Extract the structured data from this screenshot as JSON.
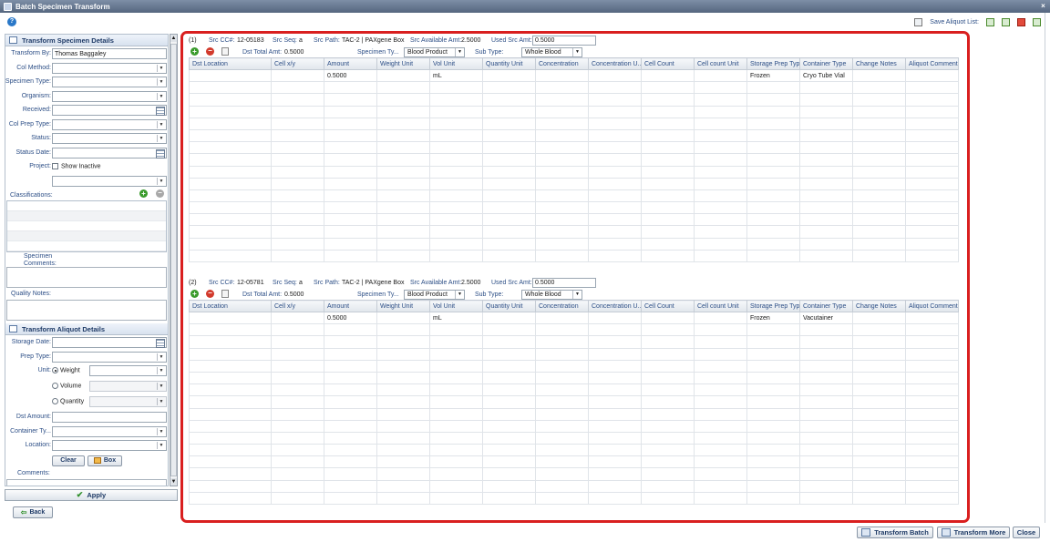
{
  "window": {
    "title": "Batch Specimen Transform",
    "help": "?",
    "close": "×"
  },
  "toolbar": {
    "save_aliquot_list": "Save Aliquot List:"
  },
  "left": {
    "specimen_section": "Transform Specimen Details",
    "transform_by_label": "Transform By:",
    "transform_by_value": "Thomas Baggaley",
    "col_method_label": "Col Method:",
    "specimen_type_label": "Specimen Type:",
    "organism_label": "Organism:",
    "received_label": "Received:",
    "col_prep_type_label": "Col Prep Type:",
    "status_label": "Status:",
    "status_date_label": "Status Date:",
    "project_label": "Project:",
    "show_inactive": "Show Inactive",
    "classifications_label": "Classifications:",
    "specimen_comments_label": "Specimen Comments:",
    "quality_notes_label": "Quality Notes:",
    "aliquot_section": "Transform Aliquot Details",
    "storage_date_label": "Storage Date:",
    "prep_type_label": "Prep Type:",
    "unit_label": "Unit:",
    "unit_weight": "Weight",
    "unit_volume": "Volume",
    "unit_quantity": "Quantity",
    "dst_amount_label": "Dst Amount:",
    "container_type_label": "Container Ty...",
    "location_label": "Location:",
    "clear_button": "Clear",
    "box_button": "Box",
    "comments_label": "Comments:",
    "apply_button": "Apply",
    "back_button": "Back"
  },
  "columns": [
    "Dst Location",
    "Cell x/y",
    "Amount",
    "Weight Unit",
    "Vol Unit",
    "Quantity Unit",
    "Concentration",
    "Concentration U...",
    "Cell Count",
    "Cell count Unit",
    "Storage Prep Type",
    "Container Type",
    "Change Notes",
    "Aliquot Comments"
  ],
  "groups": [
    {
      "index": "(1)",
      "src_cc_label": "Src CC#:",
      "src_cc": "12-05183",
      "src_seq_label": "Src Seq:",
      "src_seq": "a",
      "src_path_label": "Src Path:",
      "src_path": "TAC-2 | PAXgene Box",
      "src_avail_label": "Src Available Amt:",
      "src_avail": "2.5000",
      "used_src_label": "Used Src Amt:",
      "used_src": "0.5000",
      "dst_total_label": "Dst Total Amt:",
      "dst_total": "0.5000",
      "specimen_type_label": "Specimen Ty...",
      "specimen_type": "Blood Product",
      "sub_type_label": "Sub Type:",
      "sub_type": "Whole Blood",
      "row": [
        "",
        "",
        "0.5000",
        "",
        "mL",
        "",
        "",
        "",
        "",
        "",
        "Frozen",
        "Cryo Tube Vial",
        "",
        ""
      ]
    },
    {
      "index": "(2)",
      "src_cc_label": "Src CC#:",
      "src_cc": "12-05781",
      "src_seq_label": "Src Seq:",
      "src_seq": "a",
      "src_path_label": "Src Path:",
      "src_path": "TAC-2 | PAXgene Box",
      "src_avail_label": "Src Available Amt:",
      "src_avail": "2.5000",
      "used_src_label": "Used Src Amt:",
      "used_src": "0.5000",
      "dst_total_label": "Dst Total Amt:",
      "dst_total": "0.5000",
      "specimen_type_label": "Specimen Ty...",
      "specimen_type": "Blood Product",
      "sub_type_label": "Sub Type:",
      "sub_type": "Whole Blood",
      "row": [
        "",
        "",
        "0.5000",
        "",
        "mL",
        "",
        "",
        "",
        "",
        "",
        "Frozen",
        "Vacutainer",
        "",
        ""
      ]
    }
  ],
  "bottom": {
    "transform_batch": "Transform Batch",
    "transform_more": "Transform More",
    "close": "Close"
  },
  "colors": {
    "highlight_border": "#d91f1f",
    "label_blue": "#2c4e86"
  }
}
